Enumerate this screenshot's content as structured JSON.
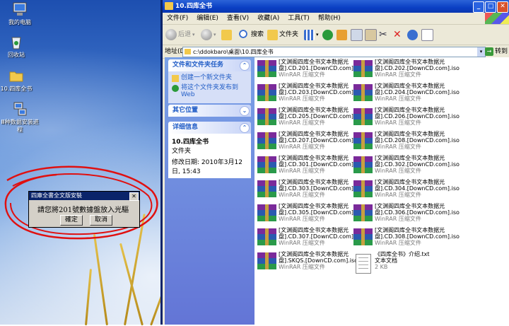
{
  "desktop": {
    "icons": [
      {
        "label": "我的电脑"
      },
      {
        "label": "回收站"
      },
      {
        "label": "10.四库全书"
      },
      {
        "label": "Ⅲ种数据安装进程"
      }
    ]
  },
  "window": {
    "title": "10.四库全书",
    "menu": [
      "文件(F)",
      "编辑(E)",
      "查看(V)",
      "收藏(A)",
      "工具(T)",
      "帮助(H)"
    ],
    "toolbar": {
      "back": "后退",
      "search": "搜索",
      "folders": "文件夹"
    },
    "address": {
      "label": "地址(D)",
      "value": "c:\\ddokbaro\\桌面\\10.四库全书",
      "go": "转到"
    },
    "taskpane": {
      "file_tasks": {
        "title": "文件和文件夹任务",
        "items": [
          "创建一个新文件夹",
          "将这个文件夹发布到 Web"
        ]
      },
      "other_places": {
        "title": "其它位置"
      },
      "details": {
        "title": "详细信息",
        "name": "10.四库全书",
        "type": "文件夹",
        "modified": "修改日期: 2010年3月12日, 15:43"
      }
    },
    "files": [
      {
        "line1": "[文渊阁四库全书文本数据光",
        "line2": "盘].CD.201.[DownCD.com].iso",
        "type": "WinRAR 压缩文件"
      },
      {
        "line1": "[文渊阁四库全书文本数据光",
        "line2": "盘].CD.202.[DownCD.com].iso",
        "type": "WinRAR 压缩文件"
      },
      {
        "line1": "[文渊阁四库全书文本数据光",
        "line2": "盘].CD.203.[DownCD.com].iso",
        "type": "WinRAR 压缩文件"
      },
      {
        "line1": "[文渊阁四库全书文本数据光",
        "line2": "盘].CD.204.[DownCD.com].iso",
        "type": "WinRAR 压缩文件"
      },
      {
        "line1": "[文渊阁四库全书文本数据光",
        "line2": "盘].CD.205.[DownCD.com].iso",
        "type": "WinRAR 压缩文件"
      },
      {
        "line1": "[文渊阁四库全书文本数据光",
        "line2": "盘].CD.206.[DownCD.com].iso",
        "type": "WinRAR 压缩文件"
      },
      {
        "line1": "[文渊阁四库全书文本数据光",
        "line2": "盘].CD.207.[DownCD.com].iso",
        "type": "WinRAR 压缩文件"
      },
      {
        "line1": "[文渊阁四库全书文本数据光",
        "line2": "盘].CD.208.[DownCD.com].iso",
        "type": "WinRAR 压缩文件"
      },
      {
        "line1": "[文渊阁四库全书文本数据光",
        "line2": "盘].CD.301.[DownCD.com].iso",
        "type": "WinRAR 压缩文件"
      },
      {
        "line1": "[文渊阁四库全书文本数据光",
        "line2": "盘].CD.302.[DownCD.com].iso",
        "type": "WinRAR 压缩文件"
      },
      {
        "line1": "[文渊阁四库全书文本数据光",
        "line2": "盘].CD.303.[DownCD.com].iso",
        "type": "WinRAR 压缩文件"
      },
      {
        "line1": "[文渊阁四库全书文本数据光",
        "line2": "盘].CD.304.[DownCD.com].iso",
        "type": "WinRAR 压缩文件"
      },
      {
        "line1": "[文渊阁四库全书文本数据光",
        "line2": "盘].CD.305.[DownCD.com].iso",
        "type": "WinRAR 压缩文件"
      },
      {
        "line1": "[文渊阁四库全书文本数据光",
        "line2": "盘].CD.306.[DownCD.com].iso",
        "type": "WinRAR 压缩文件"
      },
      {
        "line1": "[文渊阁四库全书文本数据光",
        "line2": "盘].CD.307.[DownCD.com].iso",
        "type": "WinRAR 压缩文件"
      },
      {
        "line1": "[文渊阁四库全书文本数据光",
        "line2": "盘].CD.308.[DownCD.com].iso",
        "type": "WinRAR 压缩文件"
      },
      {
        "line1": "[文渊阁四库全书文本数据光",
        "line2": "盘].SKQS.[DownCD.com].iso",
        "type": "WinRAR 压缩文件"
      },
      {
        "line1": "《四库全书》介绍.txt",
        "line2": "文本文档",
        "type": "2 KB"
      }
    ]
  },
  "dialog": {
    "title": "四庫全書全文版安裝",
    "message": "請您將201號數據盤放入光驅",
    "ok": "確定",
    "cancel": "取消"
  },
  "colors": {
    "titlebar": "#0a3fc4",
    "taskpane": "#6f8ddf",
    "annotation_red": "#e01010"
  }
}
